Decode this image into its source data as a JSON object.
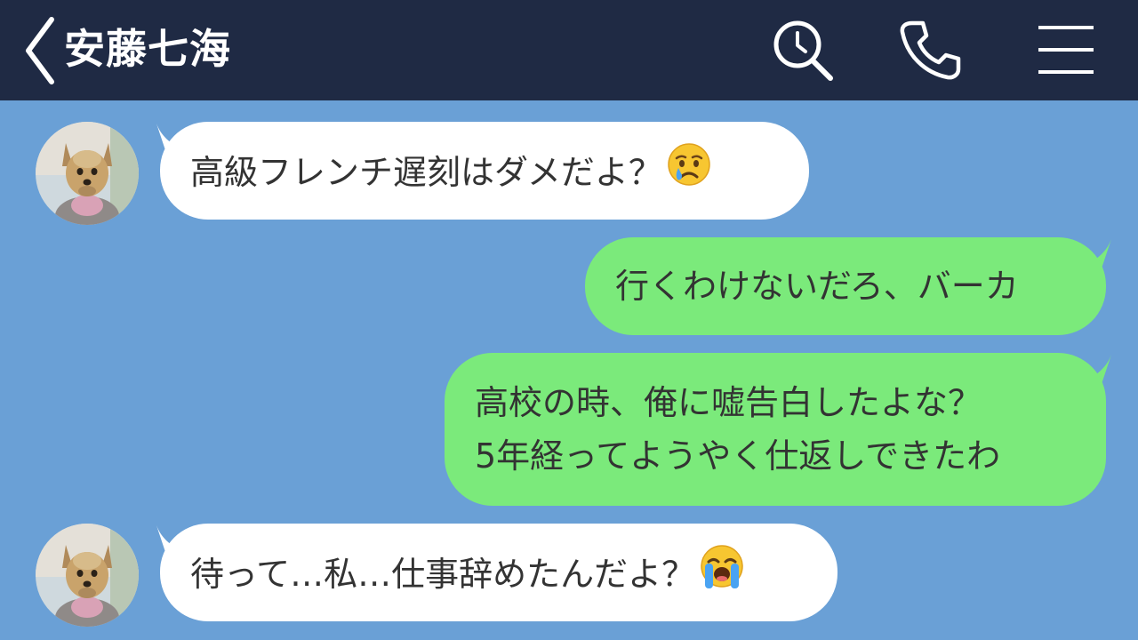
{
  "header": {
    "contact_name": "安藤七海",
    "icons": [
      "back-chevron-icon",
      "search-icon",
      "phone-icon",
      "menu-icon"
    ]
  },
  "colors": {
    "header_bg": "#1f2a44",
    "chat_bg": "#6aa0d6",
    "incoming_bubble": "#ffffff",
    "outgoing_bubble": "#7bea7b"
  },
  "messages": [
    {
      "side": "incoming",
      "lines": [
        "高級フレンチ遅刻はダメだよ？"
      ],
      "emoji": "crying-face"
    },
    {
      "side": "outgoing",
      "lines": [
        "行くわけないだろ、バーカ"
      ]
    },
    {
      "side": "outgoing",
      "lines": [
        "高校の時、俺に嘘告白したよな？",
        "5年経ってようやく仕返しできたわ"
      ]
    },
    {
      "side": "incoming",
      "lines": [
        "待って…私…仕事辞めたんだよ？"
      ],
      "emoji": "loudly-crying-face"
    }
  ]
}
